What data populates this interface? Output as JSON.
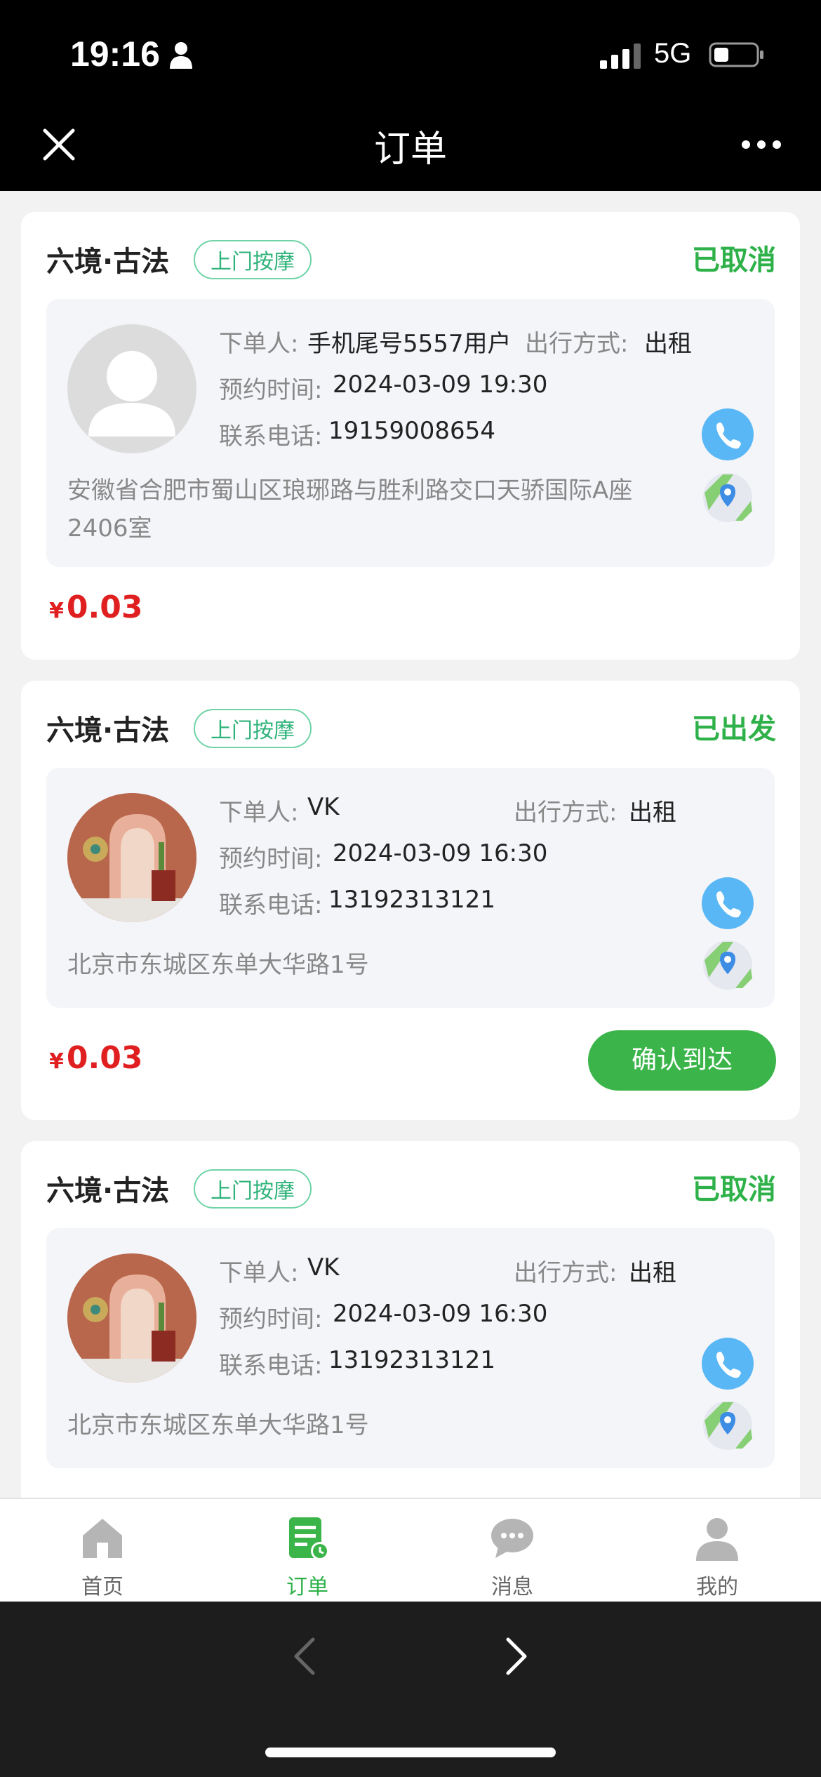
{
  "status_bar": {
    "time": "19:16",
    "network": "5G"
  },
  "nav": {
    "title": "订单"
  },
  "labels": {
    "orderer": "下单人:",
    "travel": "出行方式:",
    "appointment": "预约时间:",
    "phone": "联系电话:"
  },
  "orders": [
    {
      "shop": "六境·古法",
      "tag": "上门按摩",
      "status": "已取消",
      "orderer": "手机尾号5557用户",
      "travel": "出租",
      "time": "2024-03-09 19:30",
      "phone": "19159008654",
      "address": "安徽省合肥市蜀山区琅琊路与胜利路交口天骄国际A座2406室",
      "currency": "¥",
      "price": "0.03"
    },
    {
      "shop": "六境·古法",
      "tag": "上门按摩",
      "status": "已出发",
      "orderer": "VK",
      "travel": "出租",
      "time": "2024-03-09 16:30",
      "phone": "13192313121",
      "address": "北京市东城区东单大华路1号",
      "currency": "¥",
      "price": "0.03",
      "action": "确认到达"
    },
    {
      "shop": "六境·古法",
      "tag": "上门按摩",
      "status": "已取消",
      "orderer": "VK",
      "travel": "出租",
      "time": "2024-03-09 16:30",
      "phone": "13192313121",
      "address": "北京市东城区东单大华路1号"
    }
  ],
  "tabs": [
    {
      "label": "首页",
      "icon": "home-icon"
    },
    {
      "label": "订单",
      "icon": "order-icon",
      "active": true
    },
    {
      "label": "消息",
      "icon": "message-icon"
    },
    {
      "label": "我的",
      "icon": "profile-icon"
    }
  ],
  "colors": {
    "status_green": "#2fb14a",
    "price_red": "#e02020",
    "tag_green": "#2fb37a",
    "phone_blue": "#5ab7f5",
    "confirm_green": "#3bb54a"
  }
}
